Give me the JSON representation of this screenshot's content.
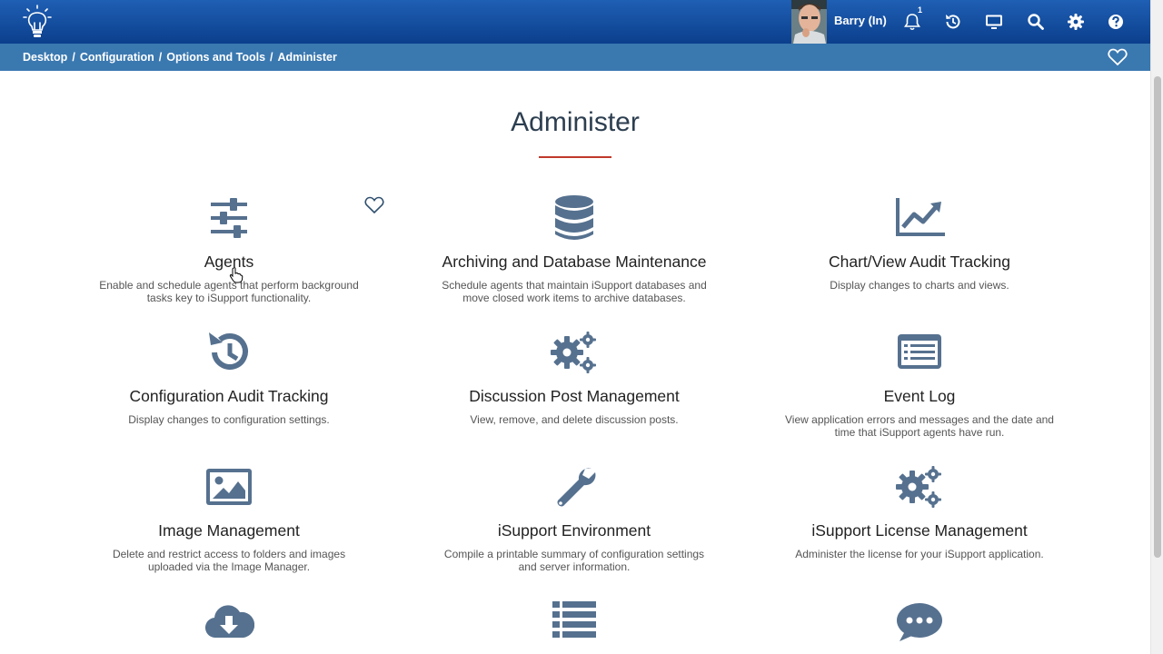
{
  "header": {
    "user_name": "Barry (In)",
    "notification_count": "1",
    "icons": [
      "lightbulb-logo-icon",
      "bell-icon",
      "history-icon",
      "monitor-icon",
      "search-icon",
      "gear-icon",
      "help-icon"
    ]
  },
  "breadcrumb": {
    "items": [
      "Desktop",
      "Configuration",
      "Options and Tools",
      "Administer"
    ],
    "separator": "/"
  },
  "page": {
    "title": "Administer"
  },
  "colors": {
    "header": "#0b3f8c",
    "breadcrumb_bar": "#3a78b0",
    "icon": "#56718f",
    "title_rule": "#c0392b"
  },
  "tiles": [
    {
      "title": "Agents",
      "desc": "Enable and schedule agents that perform background tasks key to iSupport functionality.",
      "icon": "sliders-icon"
    },
    {
      "title": "Archiving and Database Maintenance",
      "desc": "Schedule agents that maintain iSupport databases and move closed work items to archive databases.",
      "icon": "database-icon"
    },
    {
      "title": "Chart/View Audit Tracking",
      "desc": "Display changes to charts and views.",
      "icon": "line-chart-icon"
    },
    {
      "title": "Configuration Audit Tracking",
      "desc": "Display changes to configuration settings.",
      "icon": "history-icon"
    },
    {
      "title": "Discussion Post Management",
      "desc": "View, remove, and delete discussion posts.",
      "icon": "cogs-icon"
    },
    {
      "title": "Event Log",
      "desc": "View application errors and messages and the date and time that iSupport agents have run.",
      "icon": "list-alt-icon"
    },
    {
      "title": "Image Management",
      "desc": "Delete and restrict access to folders and images uploaded via the Image Manager.",
      "icon": "image-icon"
    },
    {
      "title": "iSupport Environment",
      "desc": "Compile a printable summary of configuration settings and server information.",
      "icon": "wrench-icon"
    },
    {
      "title": "iSupport License Management",
      "desc": "Administer the license for your iSupport application.",
      "icon": "cogs-icon"
    },
    {
      "title": "",
      "desc": "",
      "icon": "cloud-download-icon"
    },
    {
      "title": "",
      "desc": "",
      "icon": "list-icon"
    },
    {
      "title": "",
      "desc": "",
      "icon": "comment-dots-icon"
    }
  ]
}
